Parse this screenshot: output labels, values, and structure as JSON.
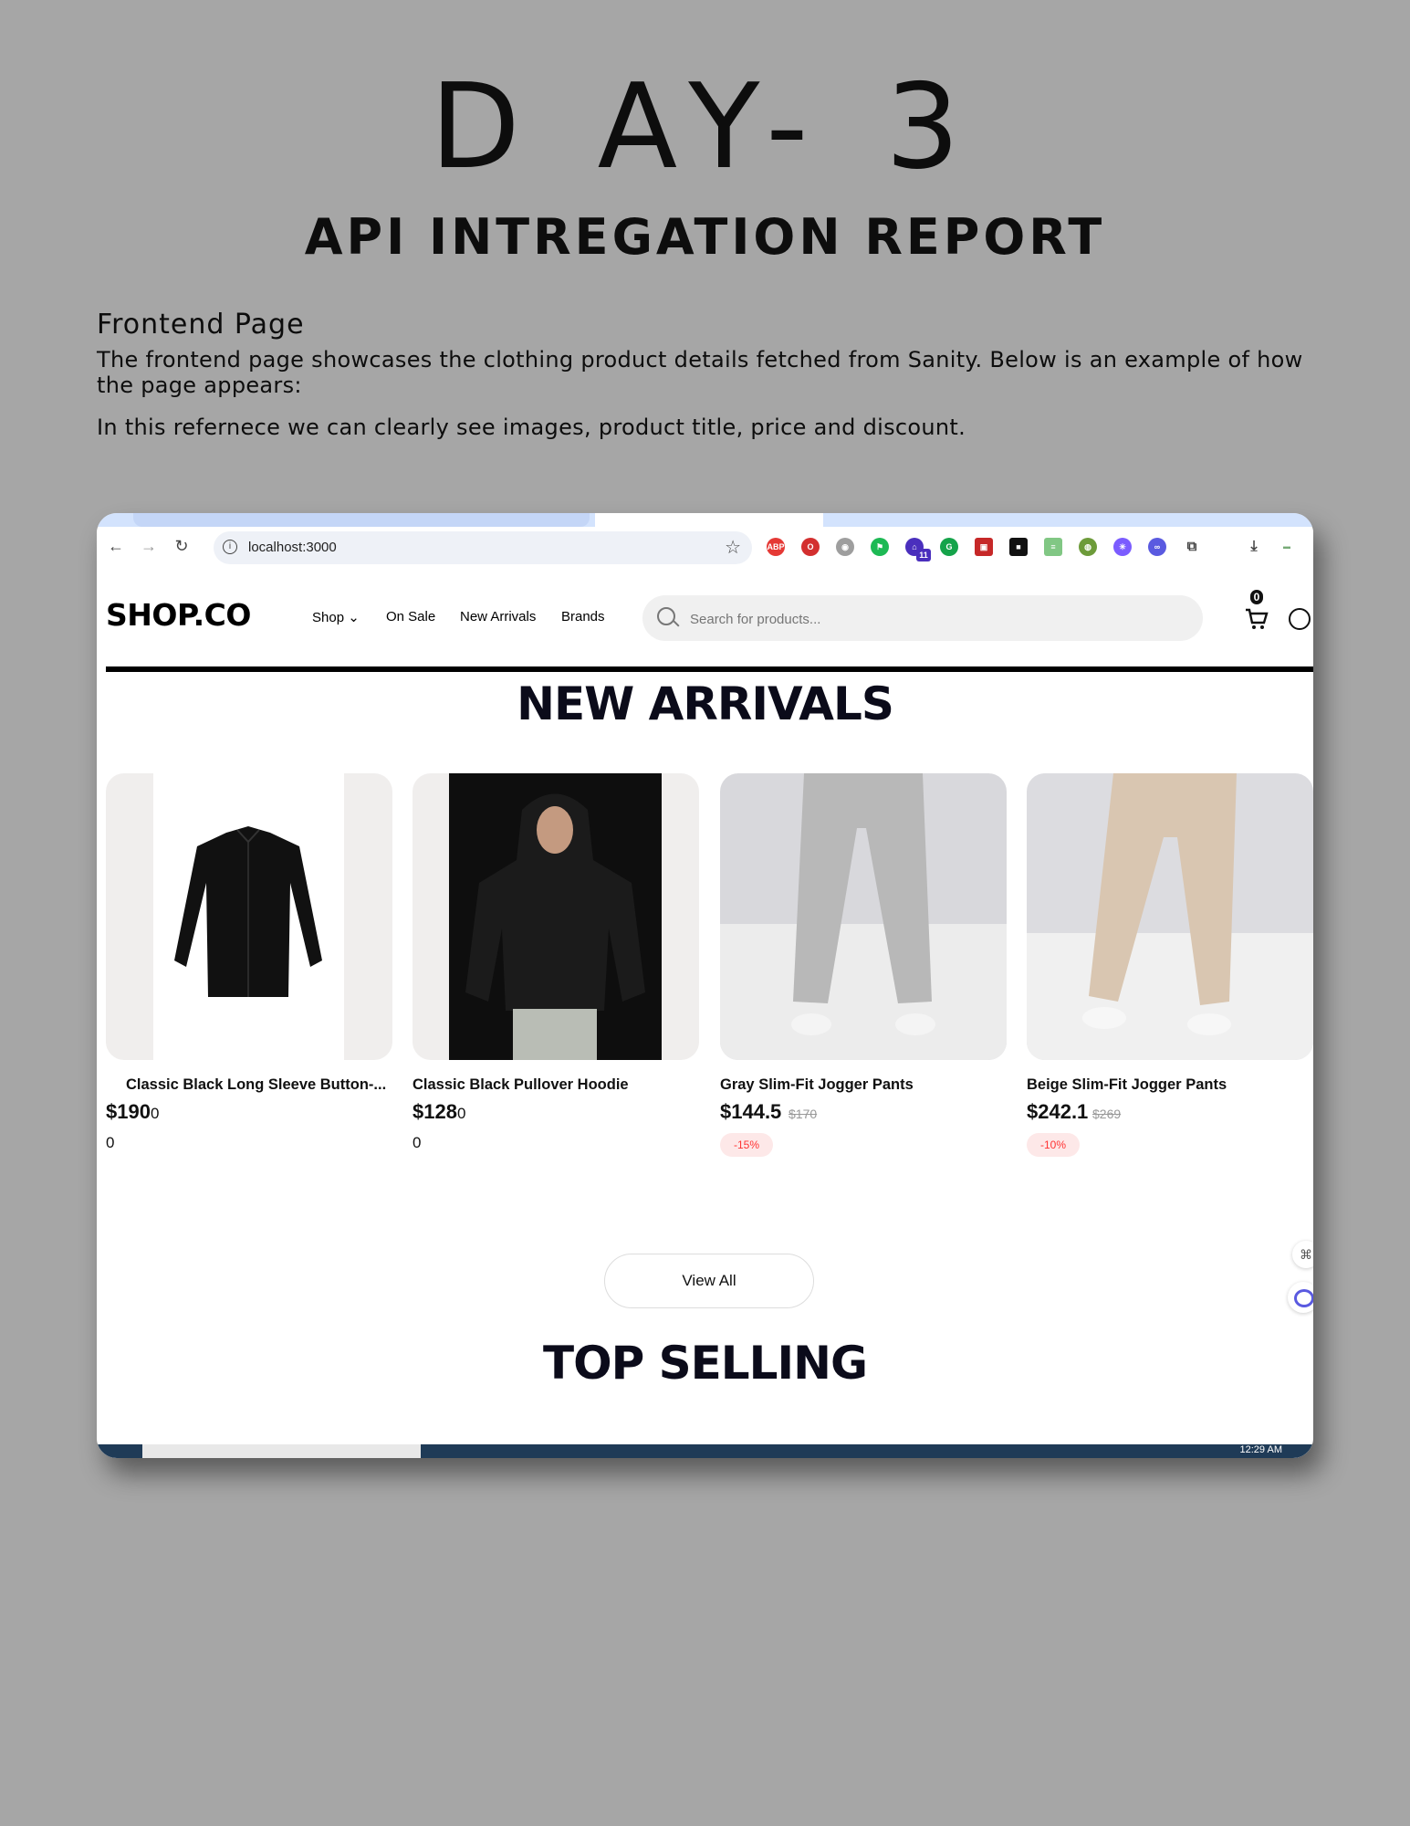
{
  "doc": {
    "title": "D AY- 3",
    "subtitle": "API INTREGATION REPORT",
    "section_heading": "Frontend Page",
    "paragraph1": "The frontend page showcases the clothing product details fetched from Sanity. Below is an example of how the page appears:",
    "paragraph2": "In this refernece we can clearly see images, product title, price and discount."
  },
  "browser": {
    "url": "localhost:3000",
    "taskbar_time": "12:29 AM",
    "extension_badge": "11"
  },
  "site": {
    "logo": "SHOP.CO",
    "menu": [
      "Shop ⌄",
      "On Sale",
      "New Arrivals",
      "Brands"
    ],
    "search_placeholder": "Search for products...",
    "cart_count": "0",
    "new_arrivals_title": "NEW ARRIVALS",
    "top_selling_title": "TOP SELLING",
    "view_all": "View All",
    "products": [
      {
        "name": "Classic Black Long Sleeve Button-...",
        "price": "$190",
        "price_suffix": "0",
        "old_price": "",
        "discount": "",
        "rating": "0"
      },
      {
        "name": "Classic Black Pullover Hoodie",
        "price": "$128",
        "price_suffix": "0",
        "old_price": "",
        "discount": "",
        "rating": "0"
      },
      {
        "name": "Gray Slim-Fit Jogger Pants",
        "price": "$144.5",
        "price_suffix": "",
        "old_price": "$170",
        "discount": "-15%",
        "rating": ""
      },
      {
        "name": "Beige Slim-Fit Jogger Pants",
        "price": "$242.1",
        "price_suffix": "",
        "old_price": "$269",
        "discount": "-10%",
        "rating": ""
      }
    ]
  },
  "colors": {
    "page_bg": "#a6a6a6",
    "discount_text": "#ff3333",
    "discount_bg": "#fde8e8",
    "taskbar": "#1f3b57"
  }
}
